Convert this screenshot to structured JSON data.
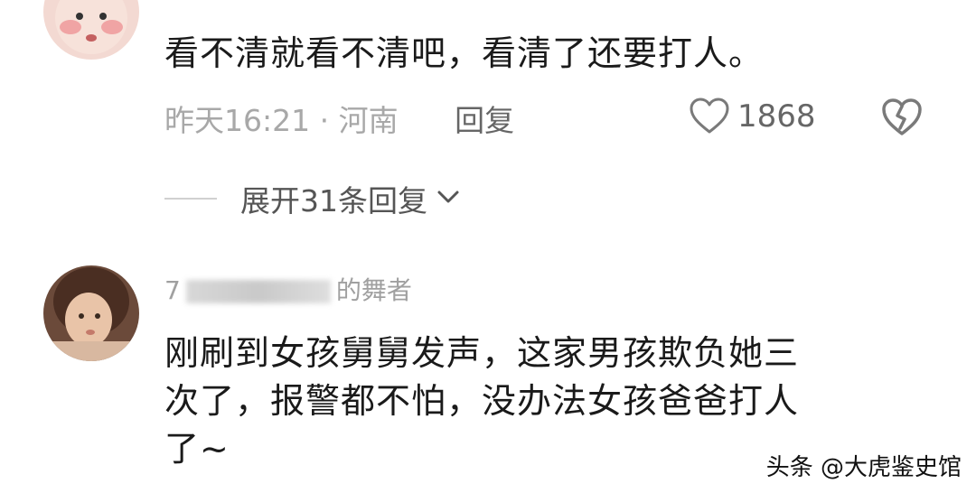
{
  "comments": [
    {
      "text": "看不清就看不清吧，看清了还要打人。",
      "time": "昨天16:21",
      "location": "河南",
      "reply_label": "回复",
      "likes": "1868",
      "expand_label": "展开31条回复"
    },
    {
      "username_start": "7",
      "username_end": "的舞者",
      "text_line1": "刚刷到女孩舅舅发声，这家男孩欺负她三",
      "text_line2": "次了，报警都不怕，没办法女孩爸爸打人",
      "text_line3": "了~"
    }
  ],
  "watermark": "头条 @大虎鉴史馆",
  "separator": "·",
  "icons": {
    "like": "heart-icon",
    "dislike": "broken-heart-icon",
    "expand": "chevron-down-icon"
  },
  "colors": {
    "meta": "#a8a8a8",
    "text": "#1a1a1a",
    "icon": "#7a7a7a"
  }
}
